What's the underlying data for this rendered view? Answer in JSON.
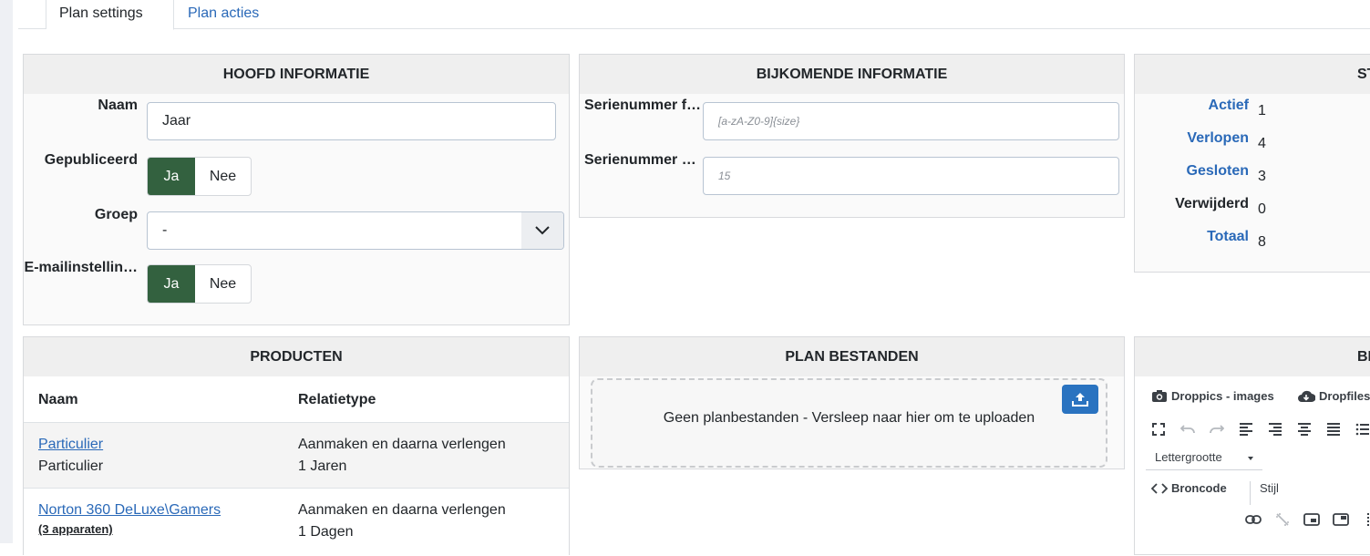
{
  "tabs": [
    {
      "label": "Plan settings",
      "active": true
    },
    {
      "label": "Plan acties",
      "active": false
    }
  ],
  "hoofd": {
    "title": "HOOFD INFORMATIE",
    "naam_label": "Naam",
    "naam_value": "Jaar",
    "gepubliceerd_label": "Gepubliceerd",
    "groep_label": "Groep",
    "groep_value": "-",
    "email_label": "E-mailinstellin…",
    "yes": "Ja",
    "no": "Nee"
  },
  "bijkomende": {
    "title": "BIJKOMENDE INFORMATIE",
    "serie1_label": "Serienummer f…",
    "serie1_placeholder": "[a-zA-Z0-9]{size}",
    "serie2_label": "Serienummer …",
    "serie2_placeholder": "15"
  },
  "stats": {
    "title": "ST",
    "items": [
      {
        "label": "Actief",
        "value": "1",
        "link": true
      },
      {
        "label": "Verlopen",
        "value": "4",
        "link": true
      },
      {
        "label": "Gesloten",
        "value": "3",
        "link": true
      },
      {
        "label": "Verwijderd",
        "value": "0",
        "link": false
      },
      {
        "label": "Totaal",
        "value": "8",
        "link": true
      }
    ]
  },
  "producten": {
    "title": "PRODUCTEN",
    "col_naam": "Naam",
    "col_relatie": "Relatietype",
    "rows": [
      {
        "link": "Particulier",
        "sub": "Particulier",
        "rel1": "Aanmaken en daarna verlengen",
        "rel2": "1 Jaren"
      },
      {
        "link": "Norton 360 DeLuxe\\Gamers",
        "sub": "(3 apparaten)",
        "rel1": "Aanmaken en daarna verlengen",
        "rel2": "1 Dagen"
      }
    ]
  },
  "bestanden": {
    "title": "PLAN BESTANDEN",
    "empty_text": "Geen planbestanden - Versleep naar hier om te uploaden"
  },
  "editor": {
    "title": "BE",
    "droppics": "Droppics - images",
    "dropfiles": "Dropfiles",
    "fontsize": "Lettergrootte",
    "broncode": "Broncode",
    "stijl": "Stijl"
  },
  "colors": {
    "accent": "#2a69b8",
    "toggle_on": "#33613f",
    "upload": "#2a73c0"
  }
}
